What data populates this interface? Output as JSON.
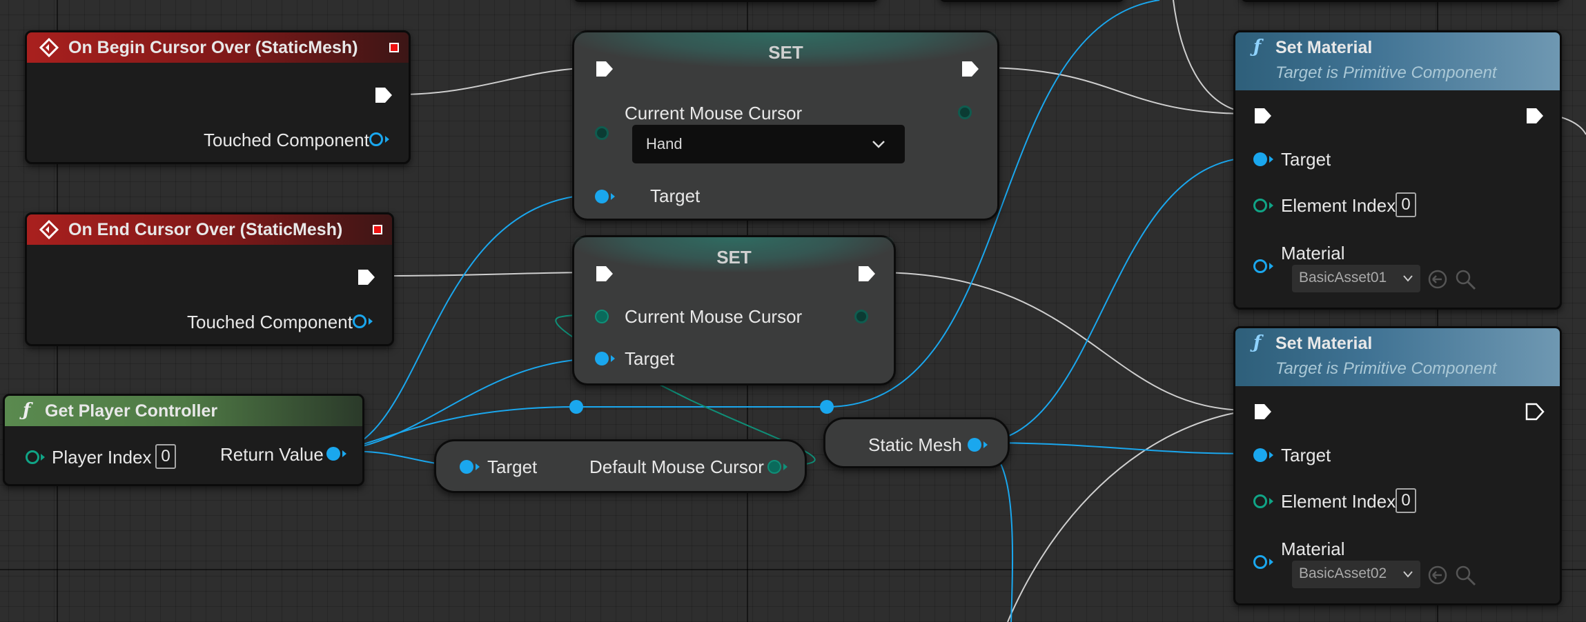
{
  "graph": {
    "event_begin": {
      "title": "On Begin Cursor Over (StaticMesh)",
      "pin_label": "Touched Component"
    },
    "event_end": {
      "title": "On End Cursor Over (StaticMesh)",
      "pin_label": "Touched Component"
    },
    "set_hand": {
      "title": "SET",
      "var_label": "Current Mouse Cursor",
      "dropdown_value": "Hand",
      "target_label": "Target"
    },
    "set_default": {
      "title": "SET",
      "var_label": "Current Mouse Cursor",
      "target_label": "Target"
    },
    "get_player_controller": {
      "title": "Get Player Controller",
      "index_label": "Player Index",
      "index_value": "0",
      "return_label": "Return Value"
    },
    "default_cursor_getter": {
      "target_label": "Target",
      "output_label": "Default Mouse Cursor"
    },
    "static_mesh_var": {
      "label": "Static Mesh"
    },
    "set_material_1": {
      "title": "Set Material",
      "subtitle": "Target is Primitive Component",
      "target_label": "Target",
      "element_label": "Element Index",
      "element_value": "0",
      "material_label": "Material",
      "material_value": "BasicAsset01"
    },
    "set_material_2": {
      "title": "Set Material",
      "subtitle": "Target is Primitive Component",
      "target_label": "Target",
      "element_label": "Element Index",
      "element_value": "0",
      "material_label": "Material",
      "material_value": "BasicAsset02"
    }
  },
  "colors": {
    "object_pin": "#1aa7ee",
    "enum_pin": "#0f8f78",
    "exec_wire": "#d8d8d8",
    "event_header": "#a9201e",
    "function_header": "#3f7293",
    "pure_header": "#5a8a4f"
  }
}
